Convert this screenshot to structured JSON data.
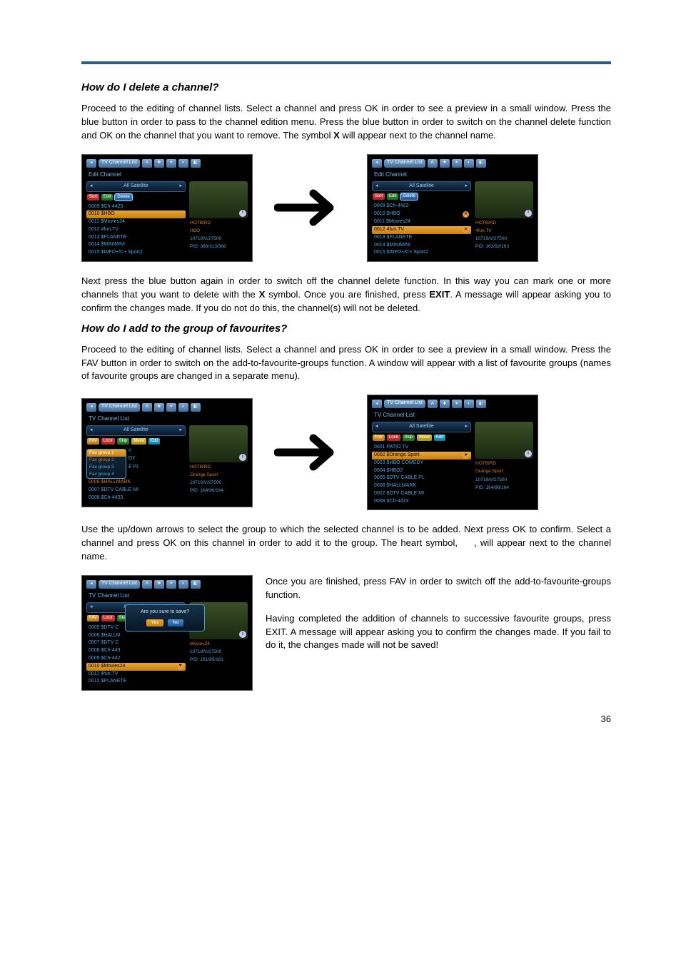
{
  "page_number": "36",
  "section1": {
    "heading": "How do I delete a channel?",
    "para1_a": "Proceed to the editing of channel lists. Select a channel and press OK in order to see a preview in a small window. Press the blue button in order to pass to the channel edition menu. Press the blue button in order to switch on the channel delete function and OK on the channel that you want to remove. The symbol ",
    "para1_x1": "X",
    "para1_b": " will appear next to the channel name.",
    "para2_a": "Next press the blue button again in order to switch off the channel delete function. In this way you can mark one or more channels that you want to delete with the ",
    "para2_x": "X",
    "para2_b": " symbol. Once you are finished, press ",
    "para2_exit": "EXIT",
    "para2_c": ". A message will appear asking you to confirm the changes made. If you do not do this, the channel(s) will not be deleted."
  },
  "section2": {
    "heading": "How do I add to the group of favourites?",
    "para1": "Proceed to the editing of channel lists. Select a channel and press OK in order to see a preview in a small window. Press the FAV button in order to switch on the add-to-favourite-groups function. A window will appear with a list of favourite groups (names of favourite groups are changed in a separate menu).",
    "para2_a": "Use the up/down arrows to select the group to which the selected channel is to be added. Next press OK to confirm. Select a channel and press OK on this channel in order to add it to the group. The heart symbol, ",
    "para2_b": ", will appear next to the channel name.",
    "para3": "Once you are finished, press FAV in order to switch off the add-to-favourite-groups function.",
    "para4": "Having completed the addition of channels to successive favourite groups, press EXIT. A message will appear asking you to confirm the changes made. If you fail to do it, the changes made will not be saved!"
  },
  "screenshots": {
    "tv_channel_list": "TV Channel List",
    "edit_channel": "Edit Channel",
    "all_satellite": "All Satellite",
    "buttons": {
      "sort": "Sort",
      "edit": "Edit",
      "delete": "Delete",
      "fav": "FAV",
      "lock": "Lock",
      "skip": "Skip",
      "move": "Move"
    },
    "delete_a_items": [
      "0009 $Ch-4423",
      "0010 $HBO",
      "0011 $Movies24",
      "0012 4fun.TV",
      "0013 $PLANETE",
      "0014 $MINIMINI",
      "0015 $INFO+/C+ Sport2"
    ],
    "meta": {
      "sat": "HOTBIRD",
      "mux_hbo": "HBO",
      "tp1": "10719/V/27500",
      "pid1": "PID: 368/313/368",
      "pid2": "PID: 163/92/163",
      "os": "Orange Sport",
      "tp2": "10719/V/27500",
      "pid3": "PID: 164/96/164",
      "m24": "Movies24",
      "pid4": "PID: 161/85/161",
      "fun": "4fun.TV"
    },
    "fav_a_items_top": [
      "0001 PATIO TV",
      "0002 $Orange Sport",
      "0003 $HBO COMEDY",
      "0004 $HBO2",
      "0005 $DTV CABLE PL",
      "0006 $HALLMARK",
      "0007 $DTV CABLE MI"
    ],
    "fav_a_items_bottom": [
      "0006 $HALLMARK",
      "0007 $DTV CABLE MI",
      "0008 $Ch-4433"
    ],
    "fav_popup": [
      "Fav group 1",
      "Fav group 2",
      "Fav group 3",
      "Fav group 4"
    ],
    "fav_popup_suffix": [
      "rt",
      "DY",
      "",
      "E PL"
    ],
    "confirm_items_top": [
      "0005 $DTV C",
      "0006 $HALLM",
      "0007 $DTV C",
      "0008 $Ch-443",
      "0009 $Ch-442"
    ],
    "confirm_items_bottom": [
      "0010 $Movies24",
      "0011 4fun.TV",
      "0012 $PLANETE"
    ],
    "dialog": {
      "text": "Are you sure to save?",
      "yes": "Yes",
      "no": "No"
    }
  }
}
